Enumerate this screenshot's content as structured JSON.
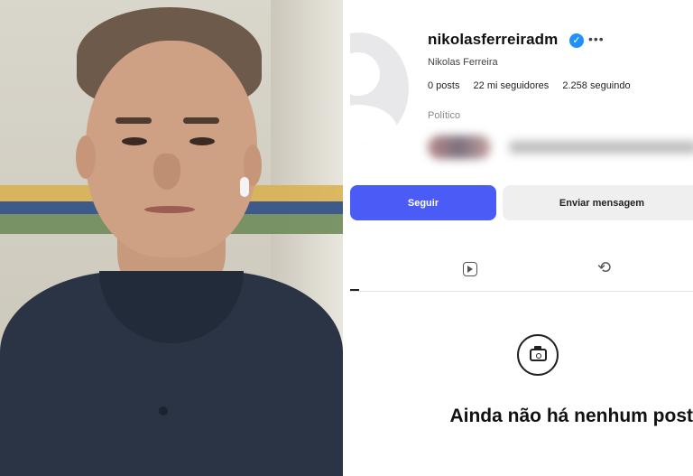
{
  "profile": {
    "username": "nikolasferreiradm",
    "full_name": "Nikolas Ferreira",
    "verified_icon": "verified-badge-icon",
    "more_icon": "more-options-icon",
    "stats": {
      "posts": "0 posts",
      "followers": "22 mi seguidores",
      "following": "2.258 seguindo"
    },
    "category": "Político"
  },
  "buttons": {
    "follow": "Seguir",
    "message": "Enviar mensagem"
  },
  "tabs": {
    "reels_icon": "reels-icon",
    "reposts_icon": "repost-icon"
  },
  "empty_state": {
    "icon": "camera-icon",
    "text": "Ainda não há nenhum post"
  },
  "colors": {
    "follow_button": "#4a5cf5",
    "verified": "#1e90ff"
  }
}
